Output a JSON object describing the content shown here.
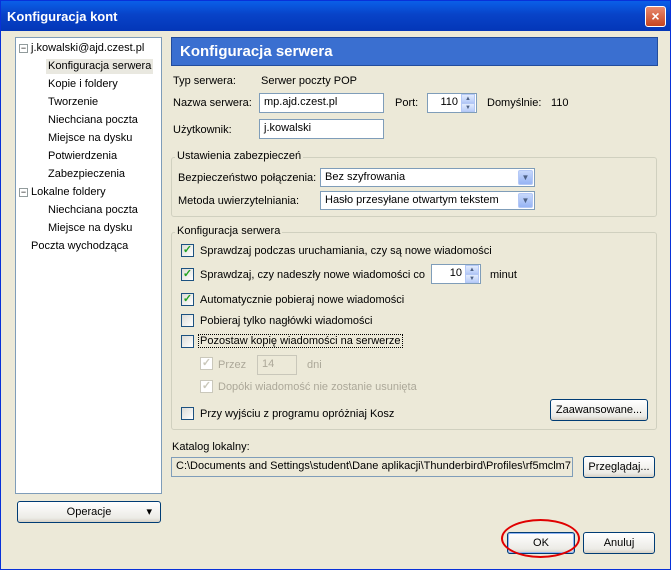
{
  "window": {
    "title": "Konfiguracja kont",
    "close_glyph": "×"
  },
  "tree": {
    "account": "j.kowalski@ajd.czest.pl",
    "account_items": [
      "Konfiguracja serwera",
      "Kopie i foldery",
      "Tworzenie",
      "Niechciana poczta",
      "Miejsce na dysku",
      "Potwierdzenia",
      "Zabezpieczenia"
    ],
    "local": "Lokalne foldery",
    "local_items": [
      "Niechciana poczta",
      "Miejsce na dysku"
    ],
    "outgoing": "Poczta wychodząca",
    "toggle_glyph": "−"
  },
  "operations_button": {
    "label": "Operacje",
    "arrow": "▾"
  },
  "header": {
    "title": "Konfiguracja serwera"
  },
  "server": {
    "type_label": "Typ serwera:",
    "type_value": "Serwer poczty POP",
    "name_label": "Nazwa serwera:",
    "name_value": "mp.ajd.czest.pl",
    "port_label": "Port:",
    "port_value": "110",
    "default_label": "Domyślnie:",
    "default_value": "110",
    "user_label": "Użytkownik:",
    "user_value": "j.kowalski"
  },
  "security": {
    "group_title": "Ustawienia zabezpieczeń",
    "connection_label": "Bezpieczeństwo połączenia:",
    "connection_value": "Bez szyfrowania",
    "auth_label": "Metoda uwierzytelniania:",
    "auth_value": "Hasło przesyłane otwartym tekstem"
  },
  "settings": {
    "group_title": "Konfiguracja serwera",
    "check_startup": "Sprawdzaj podczas uruchamiania, czy są nowe wiadomości",
    "check_every": "Sprawdzaj, czy nadeszły nowe wiadomości co",
    "check_every_value": "10",
    "check_every_unit": "minut",
    "auto_download": "Automatycznie pobieraj nowe wiadomości",
    "headers_only": "Pobieraj tylko nagłówki wiadomości",
    "leave_copy": "Pozostaw kopię wiadomości na serwerze",
    "for_label": "Przez",
    "for_value": "14",
    "for_unit": "dni",
    "until_deleted": "Dopóki wiadomość nie zostanie usunięta",
    "empty_trash": "Przy wyjściu z programu opróżniaj Kosz",
    "advanced_button": "Zaawansowane...",
    "checked_glyph": "✓"
  },
  "local_dir": {
    "label": "Katalog lokalny:",
    "value": "C:\\Documents and Settings\\student\\Dane aplikacji\\Thunderbird\\Profiles\\rf5mclm7.",
    "browse_button": "Przeglądaj..."
  },
  "footer": {
    "ok": "OK",
    "cancel": "Anuluj"
  },
  "arrows": {
    "down": "▼",
    "up": "▲"
  }
}
